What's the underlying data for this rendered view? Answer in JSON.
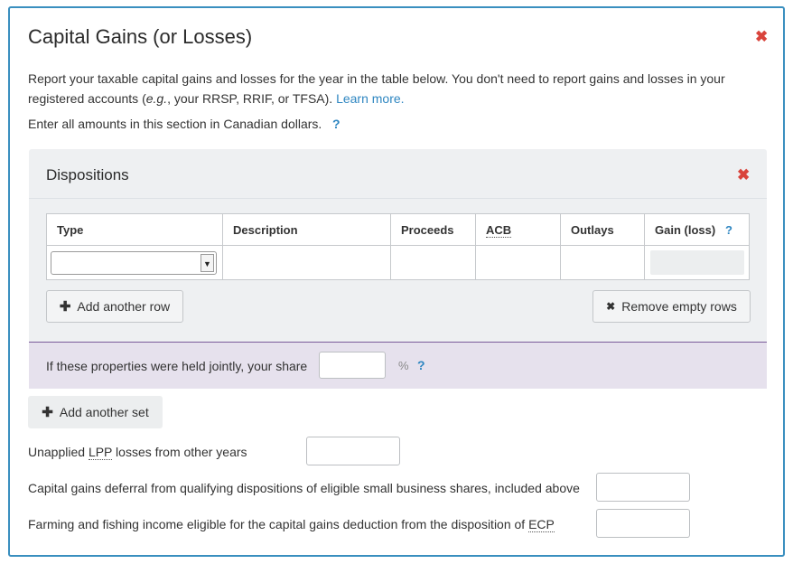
{
  "section": {
    "title": "Capital Gains (or Losses)",
    "intro_part1": "Report your taxable capital gains and losses for the year in the table below. You don't need to report gains and losses in your registered accounts (",
    "intro_eg": "e.g.",
    "intro_part2": ", your RRSP, RRIF, or TFSA). ",
    "learn_more": "Learn more.",
    "currency_note": "Enter all amounts in this section in Canadian dollars.",
    "help_glyph": "?",
    "close_glyph": "✖"
  },
  "dispositions": {
    "title": "Dispositions",
    "columns": [
      "Type",
      "Description",
      "Proceeds",
      "ACB",
      "Outlays",
      "Gain (loss)"
    ],
    "rows": [
      {
        "type": "",
        "description": "",
        "proceeds": "",
        "acb": "",
        "outlays": "",
        "gain": ""
      }
    ],
    "add_row_label": "Add another row",
    "remove_empty_label": "Remove empty rows",
    "plus_glyph": "✚",
    "x_glyph": "✖"
  },
  "joint": {
    "label": "If these properties were held jointly, your share",
    "value": "",
    "unit": "%"
  },
  "add_set_label": "Add another set",
  "fields": {
    "lpp_prefix": "Unapplied ",
    "lpp_abbr": "LPP",
    "lpp_suffix": " losses from other years",
    "lpp_value": "",
    "deferral_label": "Capital gains deferral from qualifying dispositions of eligible small business shares, included above",
    "deferral_value": "",
    "farming_prefix": "Farming and fishing income eligible for the capital gains deduction from the disposition of ",
    "farming_abbr": "ECP",
    "farming_value": ""
  },
  "colors": {
    "border": "#3a8fbf",
    "close": "#d9443c",
    "link": "#2e86c1",
    "joint_bg": "#e6e1ed",
    "joint_border": "#7a5b9a"
  }
}
